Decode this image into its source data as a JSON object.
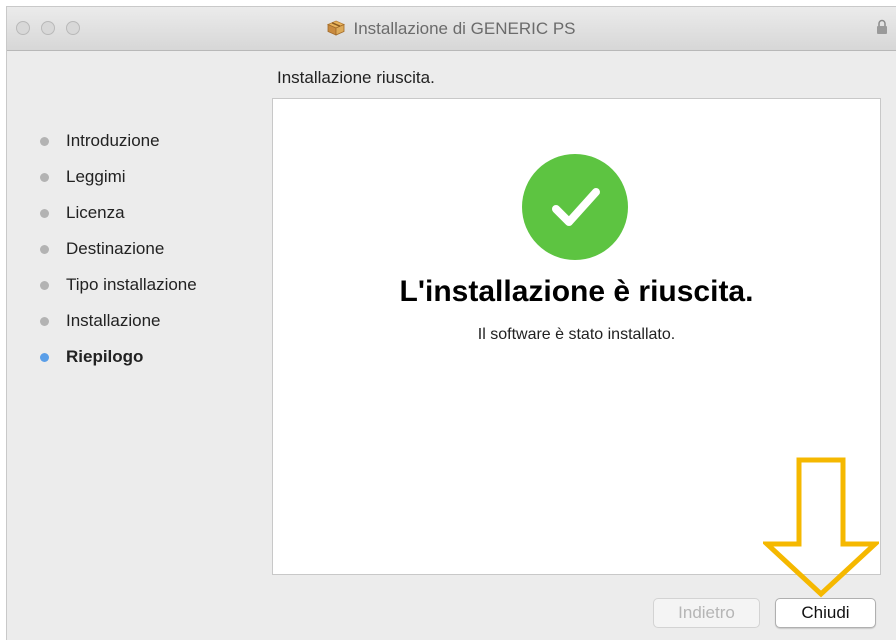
{
  "window": {
    "title": "Installazione di GENERIC PS"
  },
  "sidebar": {
    "steps": [
      {
        "label": "Introduzione"
      },
      {
        "label": "Leggimi"
      },
      {
        "label": "Licenza"
      },
      {
        "label": "Destinazione"
      },
      {
        "label": "Tipo installazione"
      },
      {
        "label": "Installazione"
      },
      {
        "label": "Riepilogo"
      }
    ],
    "active_step": "Riepilogo"
  },
  "main": {
    "heading": "Installazione riuscita.",
    "success_title": "L'installazione è riuscita.",
    "success_subtitle": "Il software è stato installato."
  },
  "buttons": {
    "back_label": "Indietro",
    "close_label": "Chiudi"
  },
  "colors": {
    "success_green": "#5dc441",
    "active_step_dot": "#5a9ee8",
    "annotation_arrow": "#f5b800"
  }
}
